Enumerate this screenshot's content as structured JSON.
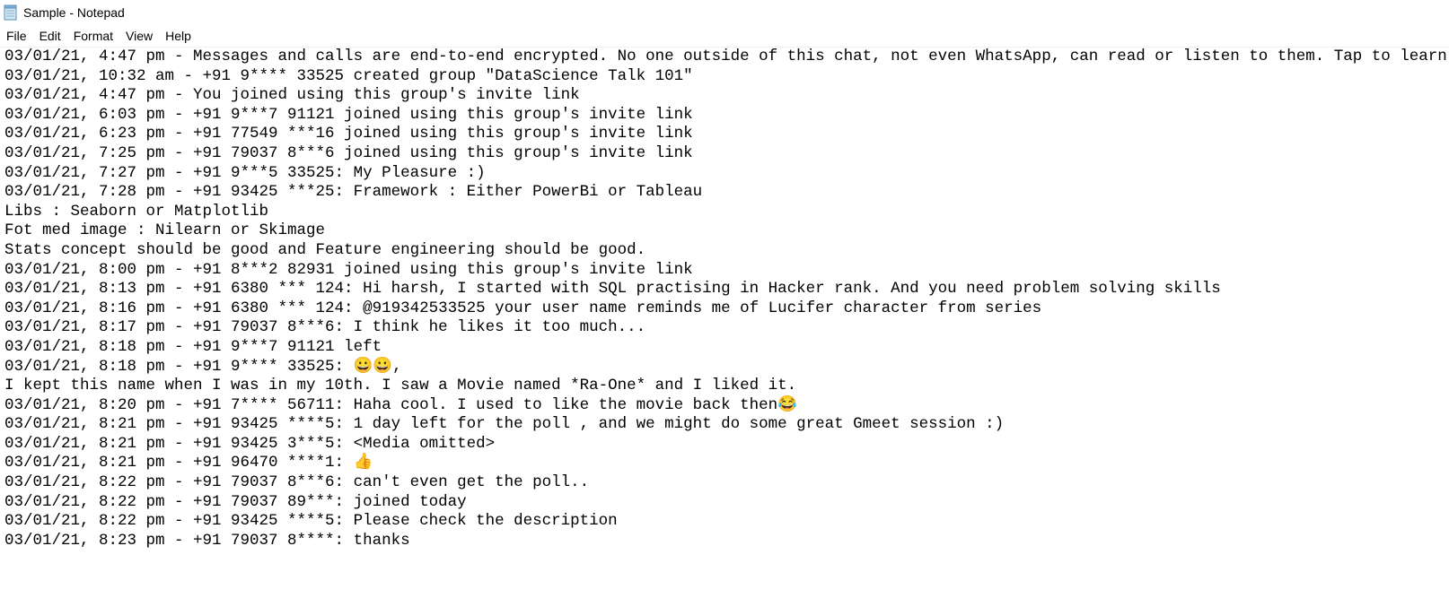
{
  "window": {
    "title": "Sample - Notepad",
    "icon": "notepad-icon"
  },
  "menu": {
    "items": [
      "File",
      "Edit",
      "Format",
      "View",
      "Help"
    ]
  },
  "editor": {
    "lines": [
      "03/01/21, 4:47 pm - Messages and calls are end-to-end encrypted. No one outside of this chat, not even WhatsApp, can read or listen to them. Tap to learn more.",
      "03/01/21, 10:32 am - +91 9**** 33525 created group \"DataScience Talk 101\"",
      "03/01/21, 4:47 pm - You joined using this group's invite link",
      "03/01/21, 6:03 pm - +91 9***7 91121 joined using this group's invite link",
      "03/01/21, 6:23 pm - +91 77549 ***16 joined using this group's invite link",
      "03/01/21, 7:25 pm - +91 79037 8***6 joined using this group's invite link",
      "03/01/21, 7:27 pm - +91 9***5 33525: My Pleasure :)",
      "03/01/21, 7:28 pm - +91 93425 ***25: Framework : Either PowerBi or Tableau",
      "Libs : Seaborn or Matplotlib",
      "Fot med image : Nilearn or Skimage",
      "Stats concept should be good and Feature engineering should be good.",
      "03/01/21, 8:00 pm - +91 8***2 82931 joined using this group's invite link",
      "03/01/21, 8:13 pm - +91 6380 *** 124: Hi harsh, I started with SQL practising in Hacker rank. And you need problem solving skills",
      "03/01/21, 8:16 pm - +91 6380 *** 124: @919342533525 your user name reminds me of Lucifer character from series",
      "03/01/21, 8:17 pm - +91 79037 8***6: I think he likes it too much...",
      "03/01/21, 8:18 pm - +91 9***7 91121 left",
      "03/01/21, 8:18 pm - +91 9**** 33525: 😀😀,",
      "I kept this name when I was in my 10th. I saw a Movie named *Ra-One* and I liked it.",
      "03/01/21, 8:20 pm - +91 7**** 56711: Haha cool. I used to like the movie back then😂",
      "03/01/21, 8:21 pm - +91 93425 ****5: 1 day left for the poll , and we might do some great Gmeet session :)",
      "03/01/21, 8:21 pm - +91 93425 3***5: <Media omitted>",
      "03/01/21, 8:21 pm - +91 96470 ****1: 👍",
      "03/01/21, 8:22 pm - +91 79037 8***6: can't even get the poll..",
      "03/01/21, 8:22 pm - +91 79037 89***: joined today",
      "03/01/21, 8:22 pm - +91 93425 ****5: Please check the description",
      "03/01/21, 8:23 pm - +91 79037 8****: thanks"
    ]
  }
}
